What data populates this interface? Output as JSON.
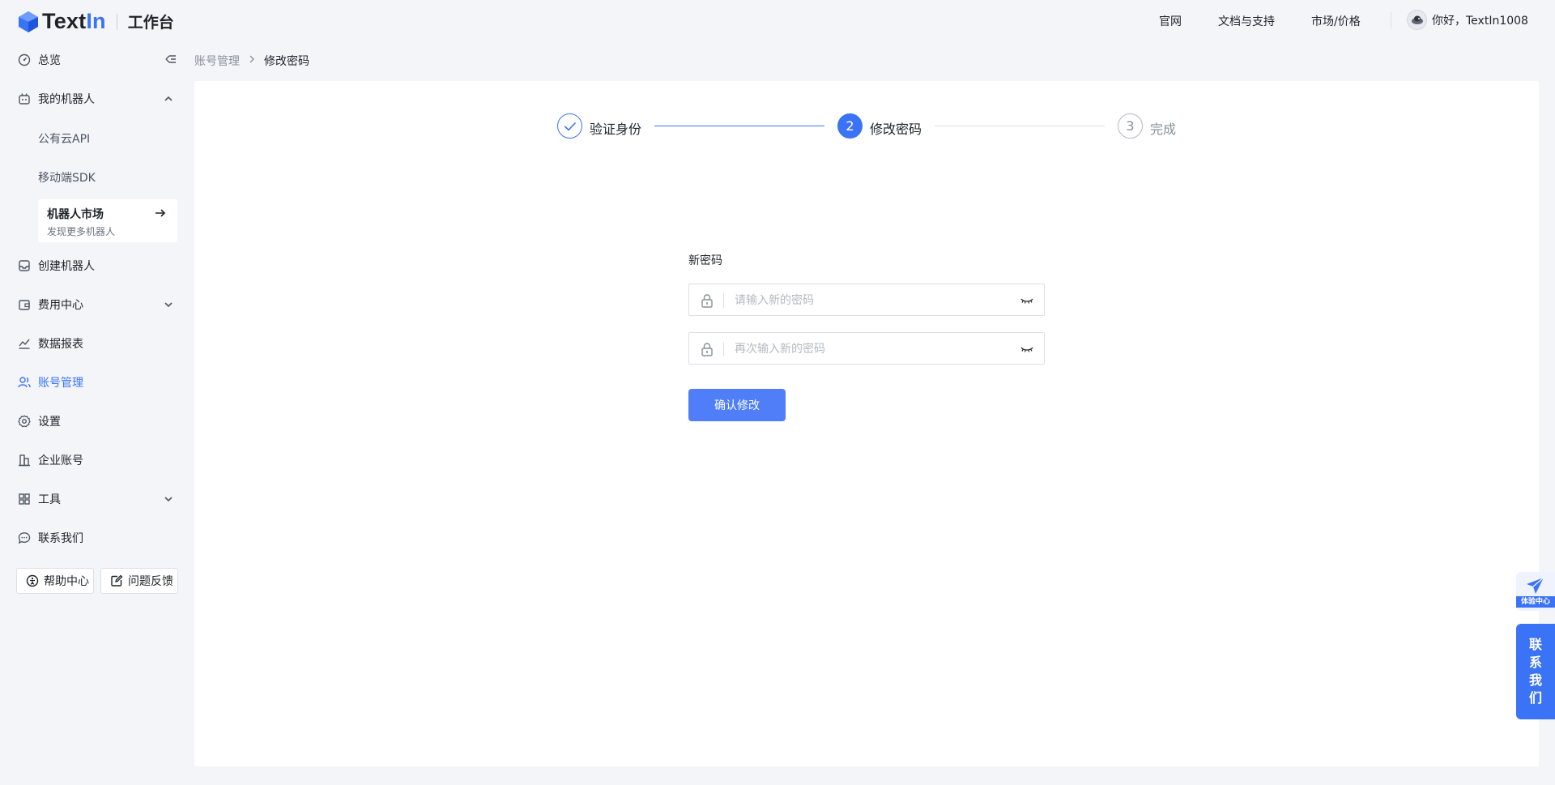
{
  "header": {
    "logo_text_a": "Text",
    "logo_text_b": "In",
    "workbench": "工作台",
    "nav": [
      "官网",
      "文档与支持",
      "市场/价格"
    ],
    "user_greeting": "你好，TextIn1008"
  },
  "sidebar": {
    "overview": "总览",
    "my_robots": "我的机器人",
    "public_cloud_api": "公有云API",
    "mobile_sdk": "移动端SDK",
    "market_title": "机器人市场",
    "market_sub": "发现更多机器人",
    "create_robot": "创建机器人",
    "billing": "费用中心",
    "reports": "数据报表",
    "account": "账号管理",
    "settings": "设置",
    "enterprise": "企业账号",
    "tools": "工具",
    "contact": "联系我们",
    "help_button": "帮助中心",
    "feedback_button": "问题反馈"
  },
  "breadcrumb": {
    "parent": "账号管理",
    "separator": ">",
    "current": "修改密码"
  },
  "steps": [
    {
      "number": "",
      "label": "验证身份",
      "state": "done"
    },
    {
      "number": "2",
      "label": "修改密码",
      "state": "active"
    },
    {
      "number": "3",
      "label": "完成",
      "state": "pending"
    }
  ],
  "form": {
    "label": "新密码",
    "new_password_placeholder": "请输入新的密码",
    "confirm_password_placeholder": "再次输入新的密码",
    "submit": "确认修改"
  },
  "floating": {
    "experience_label": "体验中心",
    "contact_chars": [
      "联",
      "系",
      "我",
      "们"
    ]
  },
  "colors": {
    "accent": "#3b73f6",
    "button": "#4f7ef8",
    "background": "#f3f5f9"
  }
}
